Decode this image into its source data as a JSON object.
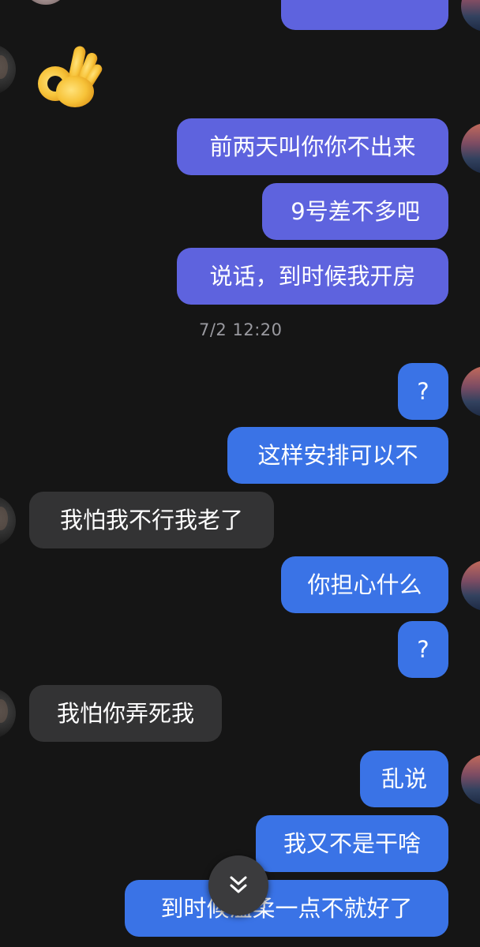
{
  "chat": {
    "timestamp": "7/2 12:20",
    "messages": [
      {
        "id": "m1",
        "side": "out",
        "text": ""
      },
      {
        "id": "m2",
        "side": "in",
        "text": "",
        "emoji": "ok-hand-emoji"
      },
      {
        "id": "m3",
        "side": "out",
        "text": "前两天叫你你不出来"
      },
      {
        "id": "m4",
        "side": "out",
        "text": "9号差不多吧"
      },
      {
        "id": "m5",
        "side": "out",
        "text": "说话，到时候我开房"
      },
      {
        "id": "m6",
        "side": "out",
        "text": "?"
      },
      {
        "id": "m7",
        "side": "out",
        "text": "这样安排可以不"
      },
      {
        "id": "m8",
        "side": "in",
        "text": "我怕我不行我老了"
      },
      {
        "id": "m9",
        "side": "out",
        "text": "你担心什么"
      },
      {
        "id": "m10",
        "side": "out",
        "text": "?"
      },
      {
        "id": "m11",
        "side": "in",
        "text": "我怕你弄死我"
      },
      {
        "id": "m12",
        "side": "out",
        "text": "乱说"
      },
      {
        "id": "m13",
        "side": "out",
        "text": "我又不是干啥"
      },
      {
        "id": "m14",
        "side": "out",
        "text": "到时候温柔一点不就好了"
      }
    ]
  },
  "scroll_button": {
    "icon": "double-chevron-down-icon"
  },
  "colors": {
    "background": "#151515",
    "outgoing_bubble": "#3a73e6",
    "outgoing_bubble_top": "#5e63de",
    "incoming_bubble": "#333334",
    "timestamp": "#9a9aa0"
  }
}
